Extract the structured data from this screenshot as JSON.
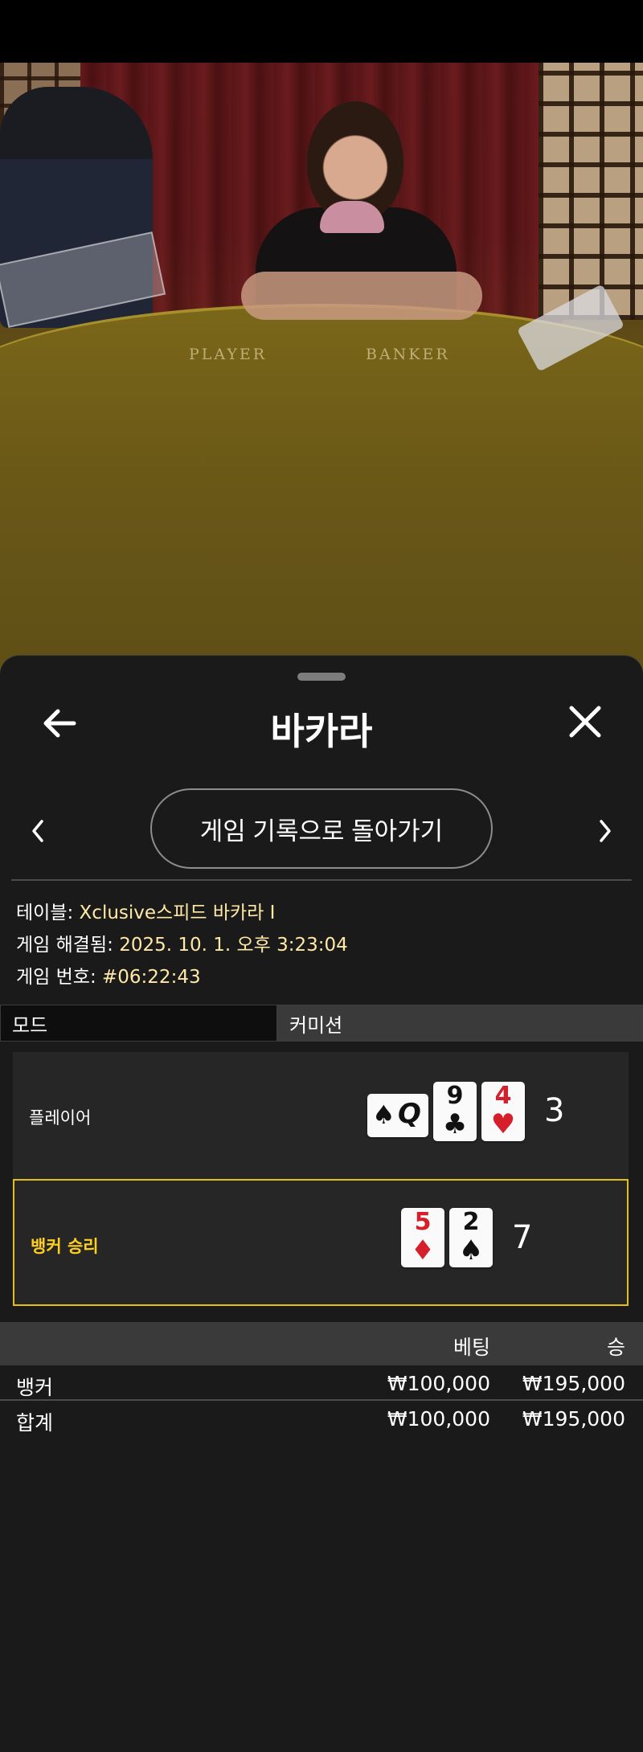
{
  "header": {
    "title": "바카라"
  },
  "nav": {
    "back_to_history": "게임 기록으로 돌아가기"
  },
  "game_info": {
    "table_label": "테이블:",
    "table_value": "Xclusive스피드 바카라 I",
    "resolved_label": "게임 해결됨:",
    "resolved_value": "2025. 10. 1. 오후 3:23:04",
    "number_label": "게임 번호:",
    "number_value": "#06:22:43"
  },
  "mode": {
    "label": "모드",
    "value": "커미션"
  },
  "video": {
    "felt_player": "PLAYER",
    "felt_banker": "BANKER"
  },
  "hands": {
    "player": {
      "label": "플레이어",
      "score": "3",
      "cards": [
        {
          "rank": "Q",
          "suit": "♠",
          "color": "#111111",
          "orientation": "sideways"
        },
        {
          "rank": "9",
          "suit": "♣",
          "color": "#111111"
        },
        {
          "rank": "4",
          "suit": "♥",
          "color": "#d51f2b"
        }
      ]
    },
    "banker": {
      "label": "뱅커 승리",
      "score": "7",
      "cards": [
        {
          "rank": "5",
          "suit": "♦",
          "color": "#d51f2b"
        },
        {
          "rank": "2",
          "suit": "♠",
          "color": "#111111"
        }
      ]
    }
  },
  "bets": {
    "headers": {
      "bet": "베팅",
      "win": "승"
    },
    "rows": [
      {
        "name": "뱅커",
        "bet": "₩100,000",
        "win": "₩195,000"
      },
      {
        "name": "합계",
        "bet": "₩100,000",
        "win": "₩195,000"
      }
    ]
  },
  "colors": {
    "accent": "#e3c013",
    "winner_text": "#ffcf1f",
    "info_value": "#ffe9a6",
    "sheet_bg": "#1a1a1a"
  }
}
